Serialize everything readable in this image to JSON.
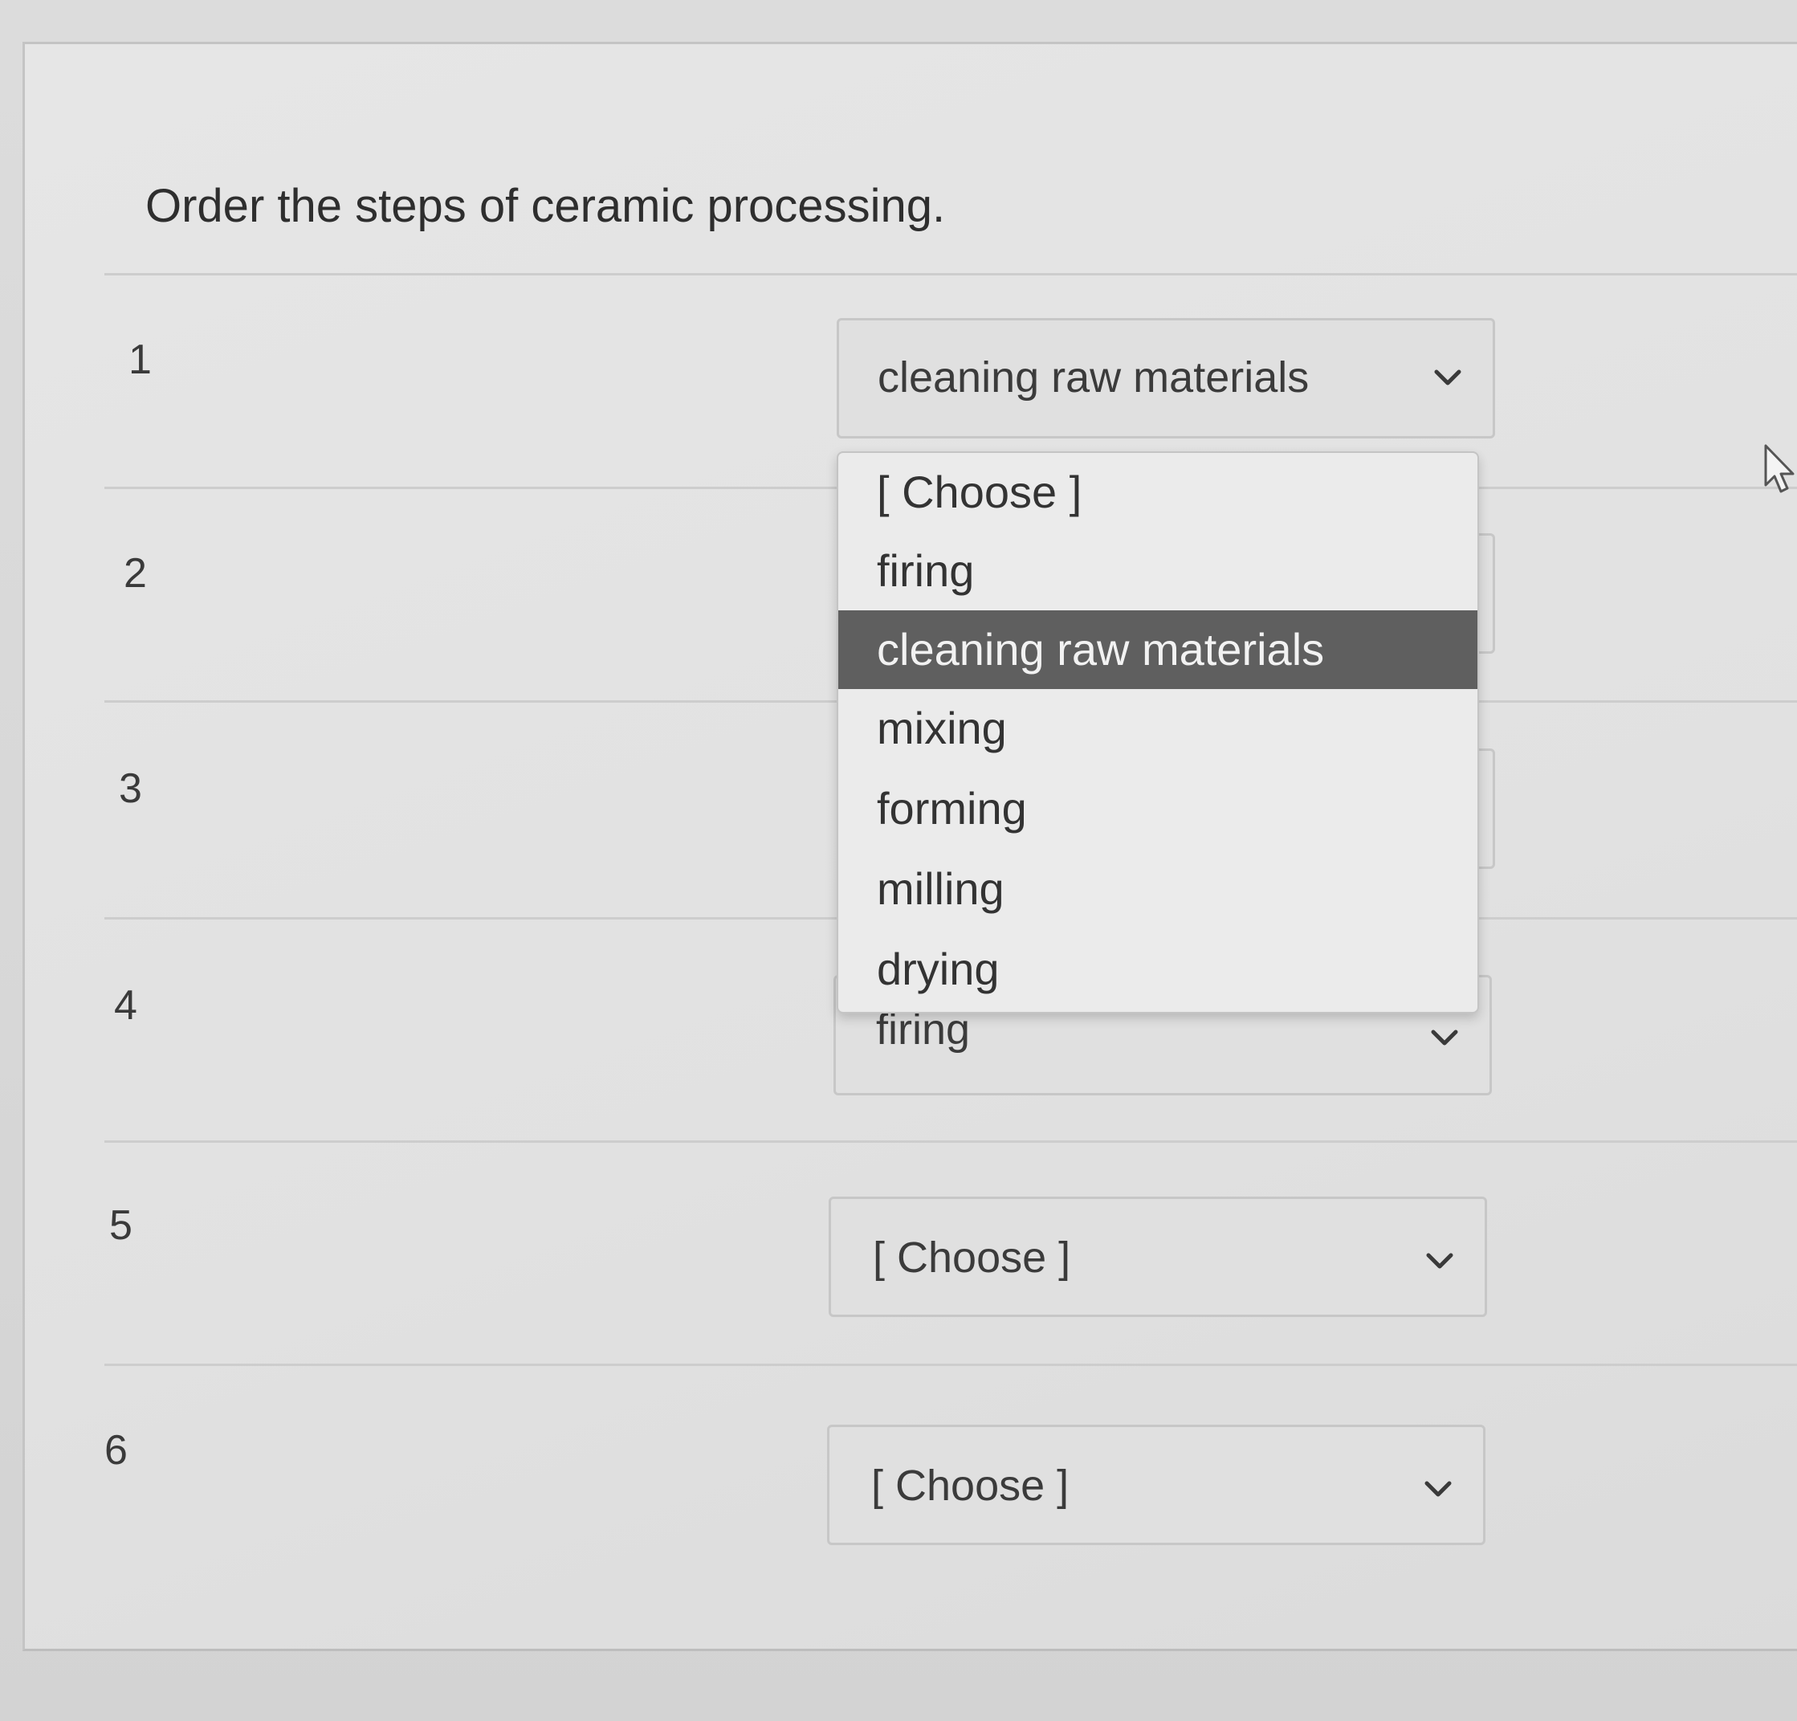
{
  "question": {
    "text": "Order the steps of ceramic processing."
  },
  "rows": [
    {
      "number": "1",
      "selected": "cleaning raw materials"
    },
    {
      "number": "2",
      "selected": ""
    },
    {
      "number": "3",
      "selected": ""
    },
    {
      "number": "4",
      "selected": "firing"
    },
    {
      "number": "5",
      "selected": "[ Choose ]"
    },
    {
      "number": "6",
      "selected": "[ Choose ]"
    }
  ],
  "dropdown": {
    "open_for_row": "1",
    "highlighted": "cleaning raw materials",
    "options": [
      "[ Choose ]",
      "firing",
      "cleaning raw materials",
      "mixing",
      "forming",
      "milling",
      "drying"
    ]
  },
  "icons": {
    "select_arrow": "chevron-down-icon",
    "mouse": "cursor-arrow-icon"
  },
  "colors": {
    "highlight_background": "#5f5f5f",
    "highlight_text": "#f2f2f2",
    "text": "#333333"
  }
}
